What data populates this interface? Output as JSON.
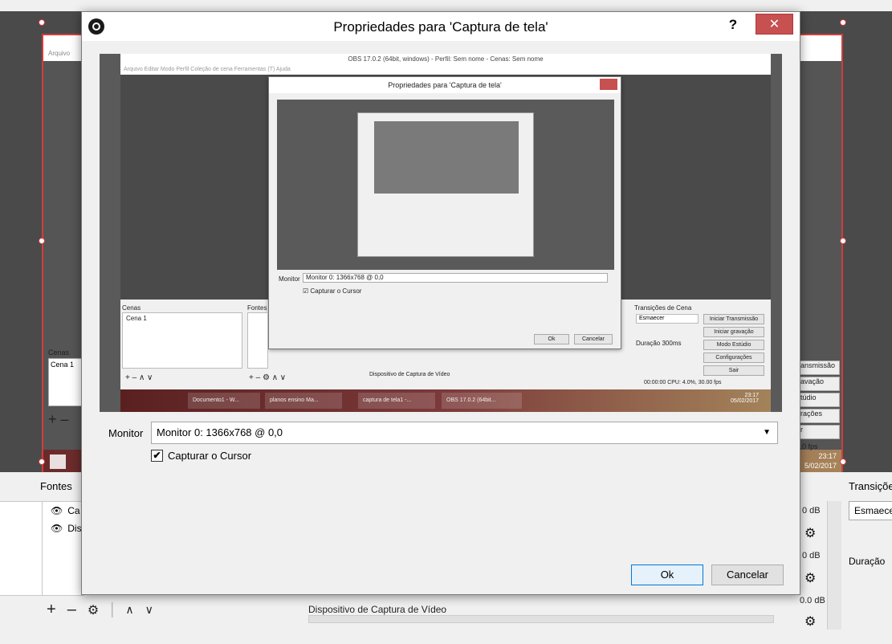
{
  "background": {
    "fontes_label": "Fontes",
    "transicoes_label": "Transiçõe",
    "sources": [
      {
        "name": "Ca"
      },
      {
        "name": "Dis"
      }
    ],
    "mixer": {
      "db_values": [
        "0 dB",
        "0 dB",
        "0.0 dB"
      ],
      "device_label": "Dispositivo de Captura de Vídeo"
    },
    "transition_select": "Esmaece",
    "duration_label": "Duração",
    "scenes_label": "Cenas",
    "scene_item": "Cena 1",
    "menu_text": "Arquivo",
    "right_buttons": [
      "ansmissão",
      "avação",
      "túdio",
      "rações",
      "r"
    ],
    "fps_text": "10 fps",
    "clock_time": "23:17",
    "clock_date": "5/02/2017"
  },
  "dialog": {
    "title": "Propriedades para 'Captura de tela'",
    "help": "?",
    "close": "✕",
    "preview": {
      "window_title": "OBS 17.0.2 (64bit, windows) - Perfil: Sem nome - Cenas: Sem nome",
      "menu": "Arquivo   Editar   Modo   Perfil   Coleção de cena   Ferramentas (T)   Ajuda",
      "inner_title": "Propriedades para 'Captura de tela'",
      "inner_monitor_label": "Monitor",
      "inner_monitor_value": "Monitor 0: 1366x768 @ 0,0",
      "inner_cursor_label": "Capturar o Cursor",
      "inner_ok": "Ok",
      "inner_cancel": "Cancelar",
      "cenas": "Cenas",
      "fontes": "Fontes",
      "cena1": "Cena 1",
      "transicoes": "Transições de Cena",
      "esmaecer": "Esmaecer",
      "duracao": "Duração",
      "duracao_value": "300ms",
      "buttons": [
        "Iniciar Transmissão",
        "Iniciar gravação",
        "Modo Estúdio",
        "Configurações",
        "Sair"
      ],
      "status": "00:00:00    CPU: 4.0%, 30.00 fps",
      "device": "Dispositivo de Captura de Vídeo",
      "tasks": [
        "Documento1 - W...",
        "planos ensino Ma...",
        "captura de tela1 -...",
        "OBS 17.0.2 (64bit..."
      ],
      "clock": "23:17",
      "date": "05/02/2017"
    },
    "monitor_label": "Monitor",
    "monitor_value": "Monitor 0: 1366x768 @ 0,0",
    "cursor_label": "Capturar o Cursor",
    "cursor_checked": true,
    "ok_label": "Ok",
    "cancel_label": "Cancelar"
  }
}
